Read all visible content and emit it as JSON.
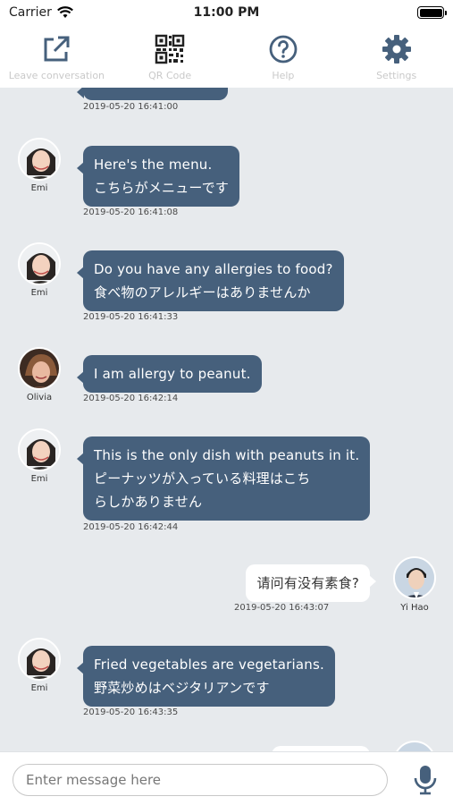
{
  "status": {
    "carrier": "Carrier",
    "time": "11:00 PM"
  },
  "toolbar": {
    "items": [
      {
        "label": "Leave conversation",
        "icon": "external-link-icon"
      },
      {
        "label": "QR Code",
        "icon": "qr-code-icon"
      },
      {
        "label": "Help",
        "icon": "help-icon"
      },
      {
        "label": "Settings",
        "icon": "gear-icon"
      }
    ]
  },
  "messages": [
    {
      "timestamp": "2019-05-20 16:41:00"
    },
    {
      "sender": "Emi",
      "lines": [
        "Here's the menu.",
        "こちらがメニューです"
      ],
      "timestamp": "2019-05-20 16:41:08"
    },
    {
      "sender": "Emi",
      "lines": [
        "Do you have any allergies to food?",
        "食べ物のアレルギーはありませんか"
      ],
      "timestamp": "2019-05-20 16:41:33"
    },
    {
      "sender": "Olivia",
      "lines": [
        "I am allergy to peanut."
      ],
      "timestamp": "2019-05-20 16:42:14"
    },
    {
      "sender": "Emi",
      "lines": [
        "This is the only dish with peanuts in it.",
        "ピーナッツが入っている料理はこち",
        "らしかありません"
      ],
      "timestamp": "2019-05-20 16:42:44"
    },
    {
      "sender": "Yi Hao",
      "lines": [
        "请问有没有素食?"
      ],
      "timestamp": "2019-05-20 16:43:07"
    },
    {
      "sender": "Emi",
      "lines": [
        "Fried vegetables are vegetarians.",
        "野菜炒めはベジタリアンです"
      ],
      "timestamp": "2019-05-20 16:43:35"
    }
  ],
  "input": {
    "placeholder": "Enter message here"
  },
  "colors": {
    "bubble_dark": "#46607c",
    "chat_bg": "#e7eaed"
  }
}
